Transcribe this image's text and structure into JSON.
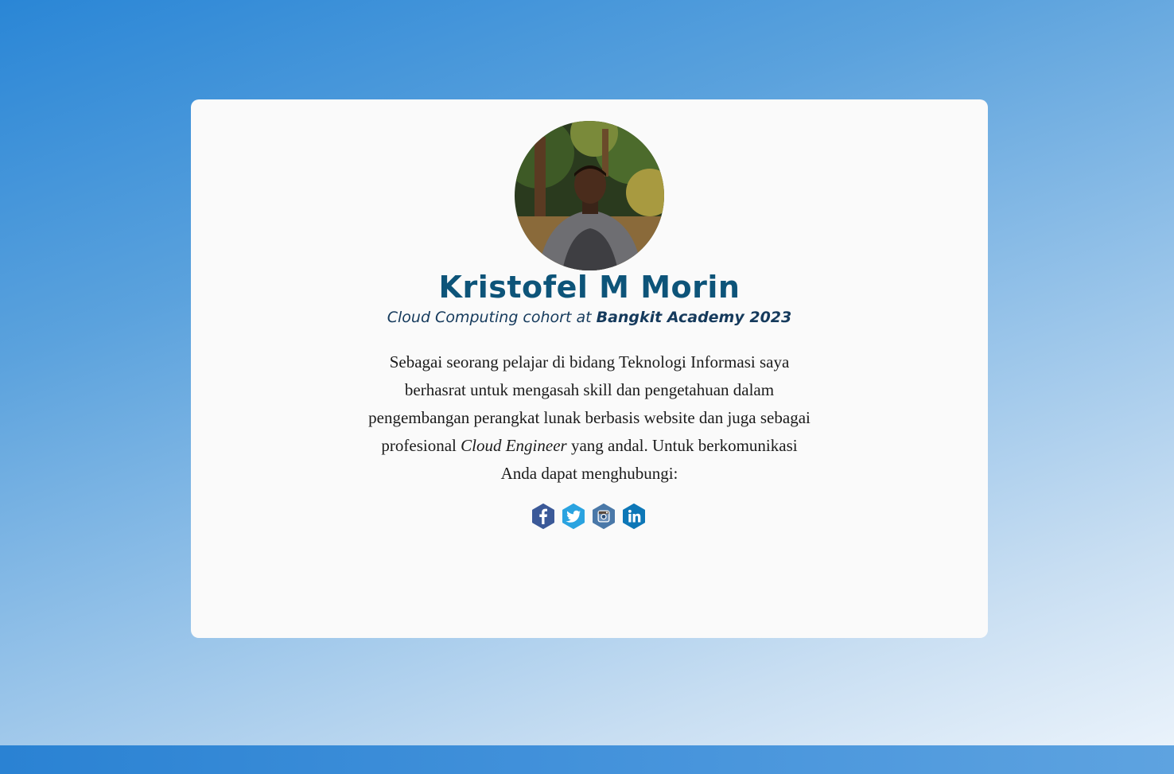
{
  "profile": {
    "name": "Kristofel M Morin",
    "tagline_prefix": "Cloud Computing cohort at ",
    "tagline_bold": "Bangkit Academy 2023",
    "bio_part1": "Sebagai seorang pelajar di bidang Teknologi Informasi saya berhasrat untuk mengasah skill dan pengetahuan dalam pengembangan perangkat lunak berbasis website dan juga sebagai profesional ",
    "bio_emphasis": "Cloud Engineer",
    "bio_part2": " yang andal. Untuk berkomunikasi Anda dapat menghubungi:"
  },
  "social_links": [
    {
      "icon": "facebook-icon",
      "color": "#3b5998"
    },
    {
      "icon": "twitter-icon",
      "color": "#2aa3e0"
    },
    {
      "icon": "instagram-icon",
      "color": "#4a78a8"
    },
    {
      "icon": "linkedin-icon",
      "color": "#0d77b7"
    }
  ],
  "colors": {
    "name": "#0d5479",
    "tagline": "#153a5c",
    "card": "#fafafa",
    "footer": "#2a82d3"
  }
}
